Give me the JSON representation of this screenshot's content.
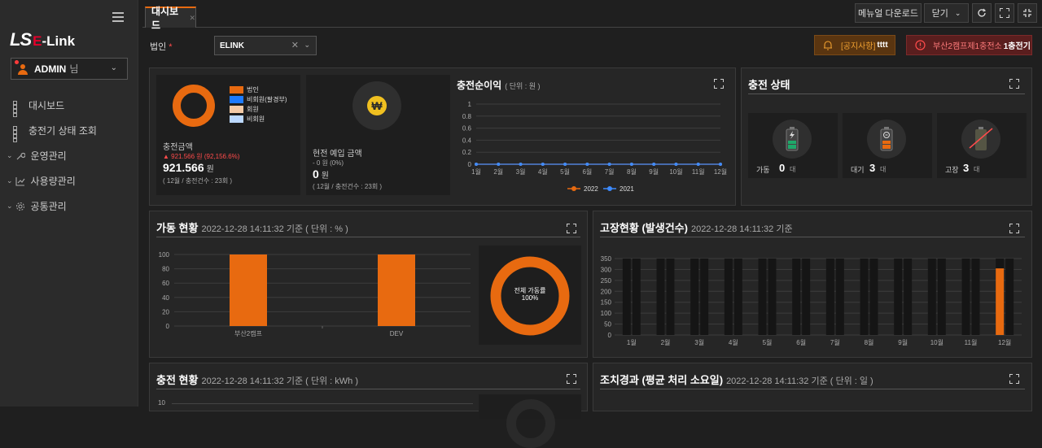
{
  "brand": {
    "ls": "LS",
    "e": "E",
    "rest": "-Link"
  },
  "user": {
    "name": "ADMIN",
    "suffix": "님"
  },
  "menu": [
    {
      "label": "대시보드"
    },
    {
      "label": "충전기 상태 조회"
    },
    {
      "label": "운영관리"
    },
    {
      "label": "사용량관리"
    },
    {
      "label": "공통관리"
    }
  ],
  "tabs": {
    "dashboard": "대시보드"
  },
  "toolbar": {
    "manual": "메뉴얼 다운로드",
    "close": "닫기"
  },
  "filter": {
    "label": "법인",
    "required": "*",
    "value": "ELINK"
  },
  "notices": {
    "warn_tag": "[공지사항]",
    "warn_text": "tttt",
    "err_text": "부산2캠프제1충전소",
    "err_strong": "1충전기"
  },
  "colors": {
    "accent": "#e86a10",
    "blue": "#3d8bff",
    "error": "#ff4b4b"
  },
  "card_amount": {
    "legend": [
      "법인",
      "비회원(팔경부)",
      "회원",
      "비회원"
    ],
    "legend_colors": [
      "#e86a10",
      "#1e7bff",
      "#f5cba7",
      "#bcd9ff"
    ],
    "title": "충전금액",
    "delta": "▲ 921.566 원 (92,156.6%)",
    "value": "921.566",
    "unit": "원",
    "foot": "( 12월 / 충전건수 : 23회 )"
  },
  "card_bank": {
    "title": "현전 예입 금액",
    "delta": "- 0 원 (0%)",
    "value": "0",
    "unit": "원",
    "foot": "( 12월 / 충전건수 : 23회 )"
  },
  "profit": {
    "title": "충전순이익",
    "unit": "( 단위 : 원 )"
  },
  "charge_status": {
    "title": "충전 상태",
    "items": [
      {
        "label": "가동",
        "value": "0",
        "unit": "대"
      },
      {
        "label": "대기",
        "value": "3",
        "unit": "대"
      },
      {
        "label": "고장",
        "value": "3",
        "unit": "대"
      }
    ]
  },
  "operation": {
    "title": "가동 현황",
    "meta": "2022-12-28 14:11:32 기준 ( 단위 : % )",
    "donut_label": "전체 가동률",
    "donut_value": "100%"
  },
  "failure": {
    "title": "고장현황 (발생건수)",
    "meta": "2022-12-28 14:11:32 기준"
  },
  "charging": {
    "title": "충전 현황",
    "meta": "2022-12-28 14:11:32 기준 ( 단위 : kWh )"
  },
  "repair": {
    "title": "조치경과 (평균 처리 소요일)",
    "meta": "2022-12-28 14:11:32 기준 ( 단위 : 일 )"
  },
  "chart_data": [
    {
      "type": "line",
      "categories": [
        "1월",
        "2월",
        "3월",
        "4월",
        "5월",
        "6월",
        "7월",
        "8월",
        "9월",
        "10월",
        "11월",
        "12월"
      ],
      "series": [
        {
          "name": "2022",
          "values": [
            0,
            0,
            0,
            0,
            0,
            0,
            0,
            0,
            0,
            0,
            0,
            0
          ]
        },
        {
          "name": "2021",
          "values": [
            0,
            0,
            0,
            0,
            0,
            0,
            0,
            0,
            0,
            0,
            0,
            0
          ]
        }
      ],
      "ylim": [
        0,
        1
      ],
      "yticks": [
        "0",
        "0.2",
        "0.4",
        "0.6",
        "0.8",
        "1"
      ],
      "legend": "bottom"
    },
    {
      "type": "bar",
      "categories": [
        "부산2캠프",
        "DEV"
      ],
      "values": [
        100,
        100
      ],
      "ylim": [
        0,
        100
      ],
      "yticks": [
        "0",
        "20",
        "40",
        "60",
        "80",
        "100"
      ]
    },
    {
      "type": "bar",
      "categories": [
        "1월",
        "2월",
        "3월",
        "4월",
        "5월",
        "6월",
        "7월",
        "8월",
        "9월",
        "10월",
        "11월",
        "12월"
      ],
      "series": [
        {
          "values": [
            350,
            350,
            350,
            350,
            350,
            350,
            350,
            350,
            350,
            350,
            350,
            350
          ]
        },
        {
          "values": [
            0,
            0,
            0,
            0,
            0,
            0,
            0,
            0,
            0,
            0,
            0,
            305
          ]
        }
      ],
      "ylim": [
        0,
        350
      ],
      "yticks": [
        "0",
        "50",
        "100",
        "150",
        "200",
        "250",
        "300",
        "350"
      ]
    },
    {
      "type": "bar",
      "yticks": [
        "10"
      ]
    }
  ]
}
